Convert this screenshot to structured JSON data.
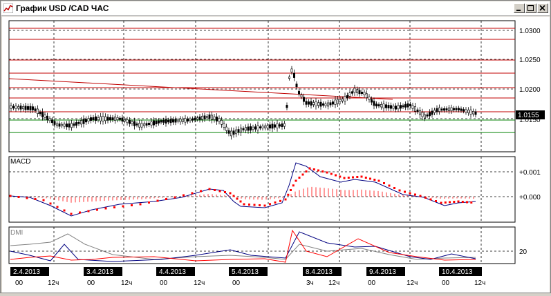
{
  "window": {
    "title": "График USD /CAD  ЧАС",
    "buttons": [
      "_",
      "□",
      "X"
    ]
  },
  "price_panel": {
    "y_ticks": [
      "1.0300",
      "1.0250",
      "1.0200",
      "1.0150"
    ],
    "current_price": "1.0155",
    "colors": {
      "resistance": "#c00000",
      "support": "#008000",
      "candle": "#000000",
      "price_tag": "#000000"
    }
  },
  "macd_panel": {
    "label": "MACD",
    "y_ticks": [
      "+0.001",
      "+0.000"
    ],
    "colors": {
      "macd": "#000080",
      "signal": "#ff0000",
      "histogram": "#ff0000"
    }
  },
  "dmi_panel": {
    "label": "DMI",
    "y_ticks": [
      "20"
    ],
    "colors": {
      "adx": "#808080",
      "plus_di": "#000080",
      "minus_di": "#ff0000"
    }
  },
  "x_axis": {
    "dates": [
      "2.4.2013",
      "3.4.2013",
      "4.4.2013",
      "5.4.2013",
      "8.4.2013",
      "9.4.2013",
      "10.4.2013"
    ],
    "hours": [
      "00",
      "12ч",
      "00",
      "12ч",
      "00",
      "12ч",
      "00",
      "3ч",
      "12ч",
      "00",
      "12ч",
      "00",
      "12ч"
    ]
  }
}
